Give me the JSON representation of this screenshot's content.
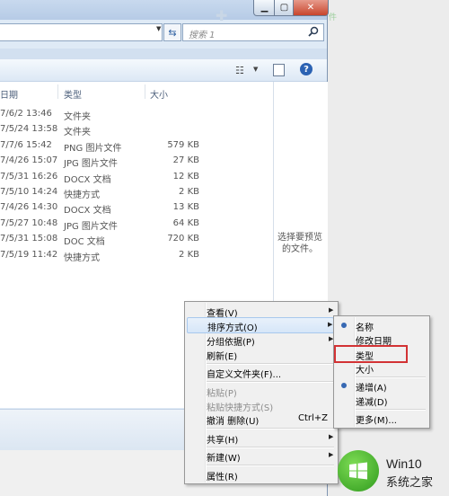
{
  "window": {
    "search_placeholder": "搜索 1",
    "close_glyph": "✕"
  },
  "columns": {
    "date": "日期",
    "type": "类型",
    "size": "大小"
  },
  "files": [
    {
      "date": "7/6/2 13:46",
      "type": "文件夹",
      "size": ""
    },
    {
      "date": "7/5/24 13:58",
      "type": "文件夹",
      "size": ""
    },
    {
      "date": "7/7/6 15:42",
      "type": "PNG 图片文件",
      "size": "579 KB"
    },
    {
      "date": "7/4/26 15:07",
      "type": "JPG 图片文件",
      "size": "27 KB"
    },
    {
      "date": "7/5/31 16:26",
      "type": "DOCX 文档",
      "size": "12 KB"
    },
    {
      "date": "7/5/10 14:24",
      "type": "快捷方式",
      "size": "2 KB"
    },
    {
      "date": "7/4/26 14:30",
      "type": "DOCX 文档",
      "size": "13 KB"
    },
    {
      "date": "7/5/27 10:48",
      "type": "JPG 图片文件",
      "size": "64 KB"
    },
    {
      "date": "7/5/31 15:08",
      "type": "DOC 文档",
      "size": "720 KB"
    },
    {
      "date": "7/5/19 11:42",
      "type": "快捷方式",
      "size": "2 KB"
    }
  ],
  "preview_text": "选择要预览的文件。",
  "context_menu": {
    "view": "查看(V)",
    "sort_by": "排序方式(O)",
    "group_by": "分组依据(P)",
    "refresh": "刷新(E)",
    "customize": "自定义文件夹(F)...",
    "paste": "粘贴(P)",
    "paste_shortcut": "粘贴快捷方式(S)",
    "undo_delete": "撤消 删除(U)",
    "undo_shortcut": "Ctrl+Z",
    "share": "共享(H)",
    "new": "新建(W)",
    "properties": "属性(R)"
  },
  "sort_submenu": {
    "name": "名称",
    "date_modified": "修改日期",
    "type": "类型",
    "size": "大小",
    "ascending": "递增(A)",
    "descending": "递减(D)",
    "more": "更多(M)..."
  },
  "watermark": {
    "title": "Win10",
    "subtitle": "系统之家"
  },
  "colors": {
    "accent": "#3769b3",
    "highlight_border": "#d23234",
    "watermark_green": "#3fb22a"
  }
}
